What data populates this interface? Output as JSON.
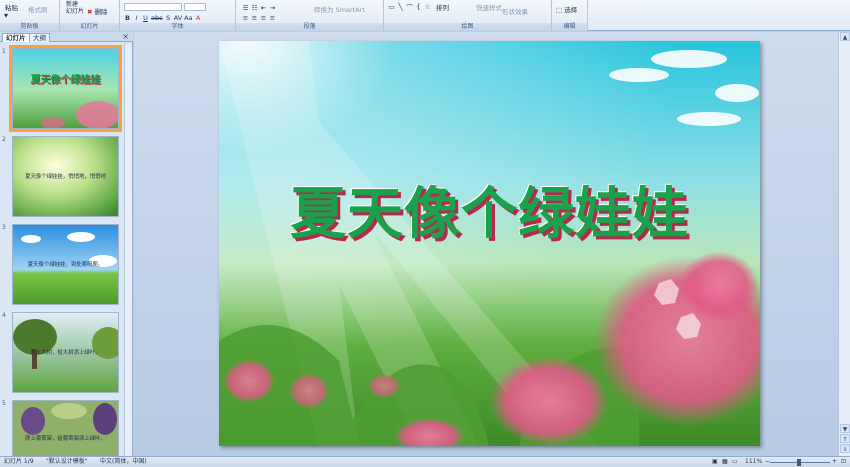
{
  "ribbon": {
    "clipboard": {
      "paste_label": "粘贴",
      "format_painter_label": "格式刷",
      "group_label": "剪贴板"
    },
    "slides": {
      "new_slide_label": "新建\n幻灯片",
      "delete_label": "删除",
      "group_label": "幻灯片"
    },
    "font": {
      "group_label": "字体",
      "bold": "B",
      "italic": "I",
      "underline": "U",
      "strike": "abc",
      "shadow": "S",
      "spacing": "AV",
      "case": "Aa",
      "color": "A"
    },
    "paragraph": {
      "group_label": "段落",
      "smartart_label": "转换为 SmartArt"
    },
    "drawing": {
      "group_label": "绘图",
      "arrange_label": "排列",
      "quick_styles_label": "快速样式",
      "shape_effect_label": "形状效果"
    },
    "editing": {
      "group_label": "编辑",
      "select_label": "选择"
    }
  },
  "left_panel": {
    "tabs": [
      {
        "label": "幻灯片"
      },
      {
        "label": "大纲"
      }
    ],
    "close_label": "×",
    "thumbnails": [
      {
        "number": "1",
        "text": "夏天像个绿娃娃"
      },
      {
        "number": "2",
        "text": "夏天像个绿娃娃，悄悄地，悄悄地"
      },
      {
        "number": "3",
        "text": "夏天像个绿娃娃，到处爬呀爬。"
      },
      {
        "number": "4",
        "text": "爬上大树，给大树添上绿叶。"
      },
      {
        "number": "5",
        "text": "爬上葡萄架，给葡萄架添上绿叶。"
      }
    ]
  },
  "slide": {
    "title": "夏天像个绿娃娃"
  },
  "status_bar": {
    "slide_counter": "幻灯片 1/9",
    "theme": "\"默认设计模板\"",
    "language": "中文(简体，中国)",
    "zoom": "111%"
  },
  "colors": {
    "title_green": "#1aa14b",
    "title_shadow": "#b5294a",
    "selection_orange": "#f9a43a"
  }
}
